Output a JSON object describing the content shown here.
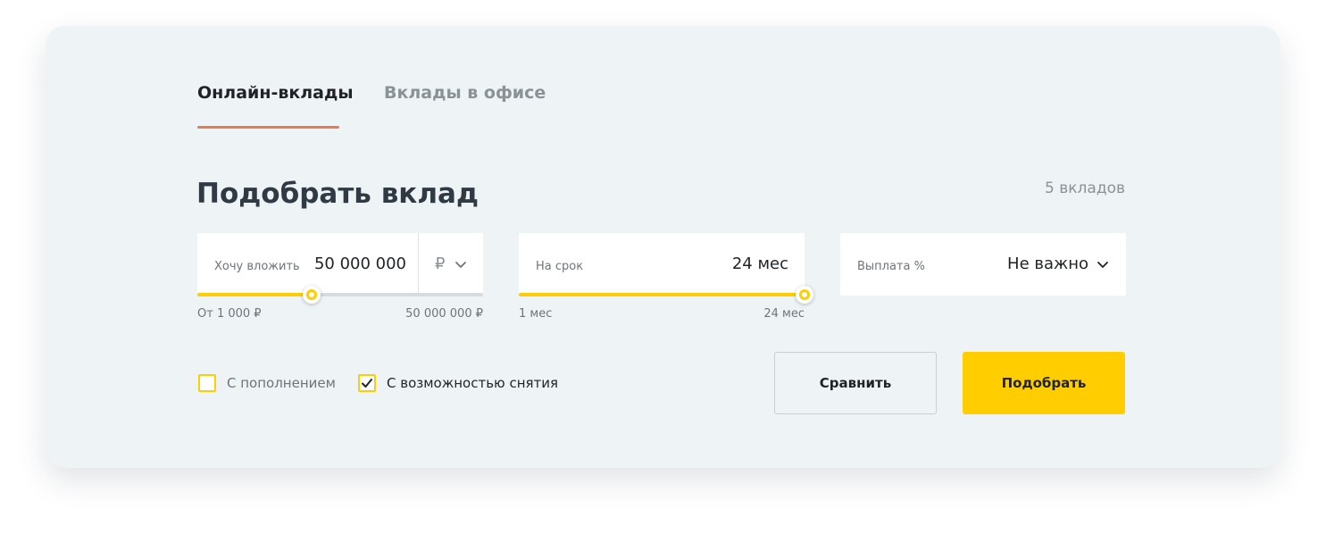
{
  "tabs": [
    {
      "label": "Онлайн-вклады",
      "active": true
    },
    {
      "label": "Вклады в офисе",
      "active": false
    }
  ],
  "title": "Подобрать вклад",
  "results_count": "5 вкладов",
  "amount": {
    "label": "Хочу вложить",
    "value": "50 000 000",
    "currency": "₽",
    "min_label": "От 1 000 ₽",
    "max_label": "50 000 000 ₽",
    "slider_fraction": 0.4
  },
  "term": {
    "label": "На срок",
    "value": "24 мес",
    "min_label": "1 мес",
    "max_label": "24 мес",
    "slider_fraction": 1.0
  },
  "payout": {
    "label": "Выплата %",
    "value": "Не важно"
  },
  "checkboxes": [
    {
      "label": "С пополнением",
      "checked": false
    },
    {
      "label": "С возможностью снятия",
      "checked": true
    }
  ],
  "buttons": {
    "compare": "Сравнить",
    "submit": "Подобрать"
  },
  "colors": {
    "accent_yellow": "#ffcd00",
    "tab_underline": "#eb7a53",
    "panel_background": "#eef3f5"
  },
  "icons": {
    "currency_dropdown": "chevron-down-icon",
    "payout_dropdown": "chevron-down-icon",
    "checkbox_checked": "checkmark-icon"
  }
}
